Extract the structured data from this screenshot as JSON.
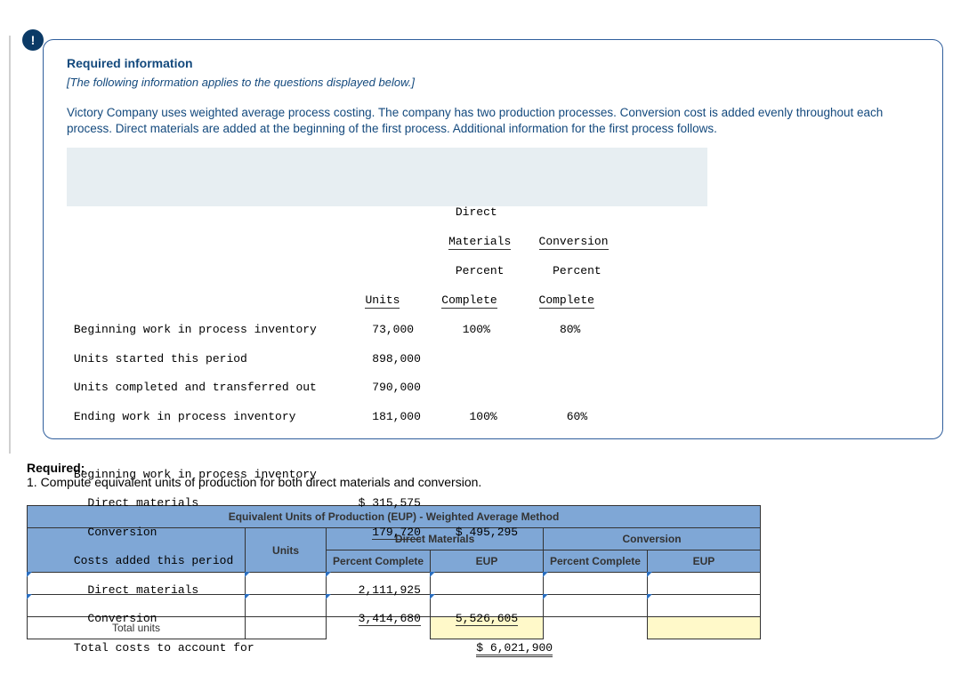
{
  "badge": "!",
  "info": {
    "title": "Required information",
    "note": "[The following information applies to the questions displayed below.]",
    "body": "Victory Company uses weighted average process costing. The company has two production processes. Conversion cost is added evenly throughout each process. Direct materials are added at the beginning of the first process. Additional information for the first process follows."
  },
  "units_table": {
    "col_units": "Units",
    "col_dm_top": "Direct",
    "col_dm_mid": "Materials",
    "col_dm_pct1": "Percent",
    "col_dm_pct2": "Complete",
    "col_cv_top": "Conversion",
    "col_cv_pct1": "Percent",
    "col_cv_pct2": "Complete",
    "rows": {
      "beg_wip": {
        "label": "Beginning work in process inventory",
        "units": "73,000",
        "dm": "100%",
        "cv": "80%"
      },
      "started": {
        "label": "Units started this period",
        "units": "898,000"
      },
      "completed": {
        "label": "Units completed and transferred out",
        "units": "790,000"
      },
      "end_wip": {
        "label": "Ending work in process inventory",
        "units": "181,000",
        "dm": "100%",
        "cv": "60%"
      }
    }
  },
  "cost_table": {
    "beg_wip_hdr": "Beginning work in process inventory",
    "dm_label": "Direct materials",
    "dm_val": "$ 315,575",
    "cv_label": "Conversion",
    "cv_val": "179,720",
    "beg_total": "$ 495,295",
    "added_hdr": "Costs added this period",
    "add_dm_label": "Direct materials",
    "add_dm_val": "2,111,925",
    "add_cv_label": "Conversion",
    "add_cv_val": "3,414,680",
    "add_total": "5,526,605",
    "total_label": "Total costs to account for",
    "grand_total": "$ 6,021,900"
  },
  "question": {
    "req": "Required:",
    "q1": "1. Compute equivalent units of production for both direct materials and conversion."
  },
  "answer": {
    "title": "Equivalent Units of Production (EUP) - Weighted Average Method",
    "dm_hdr": "Direct Materials",
    "cv_hdr": "Conversion",
    "units": "Units",
    "pct": "Percent Complete",
    "eup": "EUP",
    "total_row": "Total units"
  }
}
